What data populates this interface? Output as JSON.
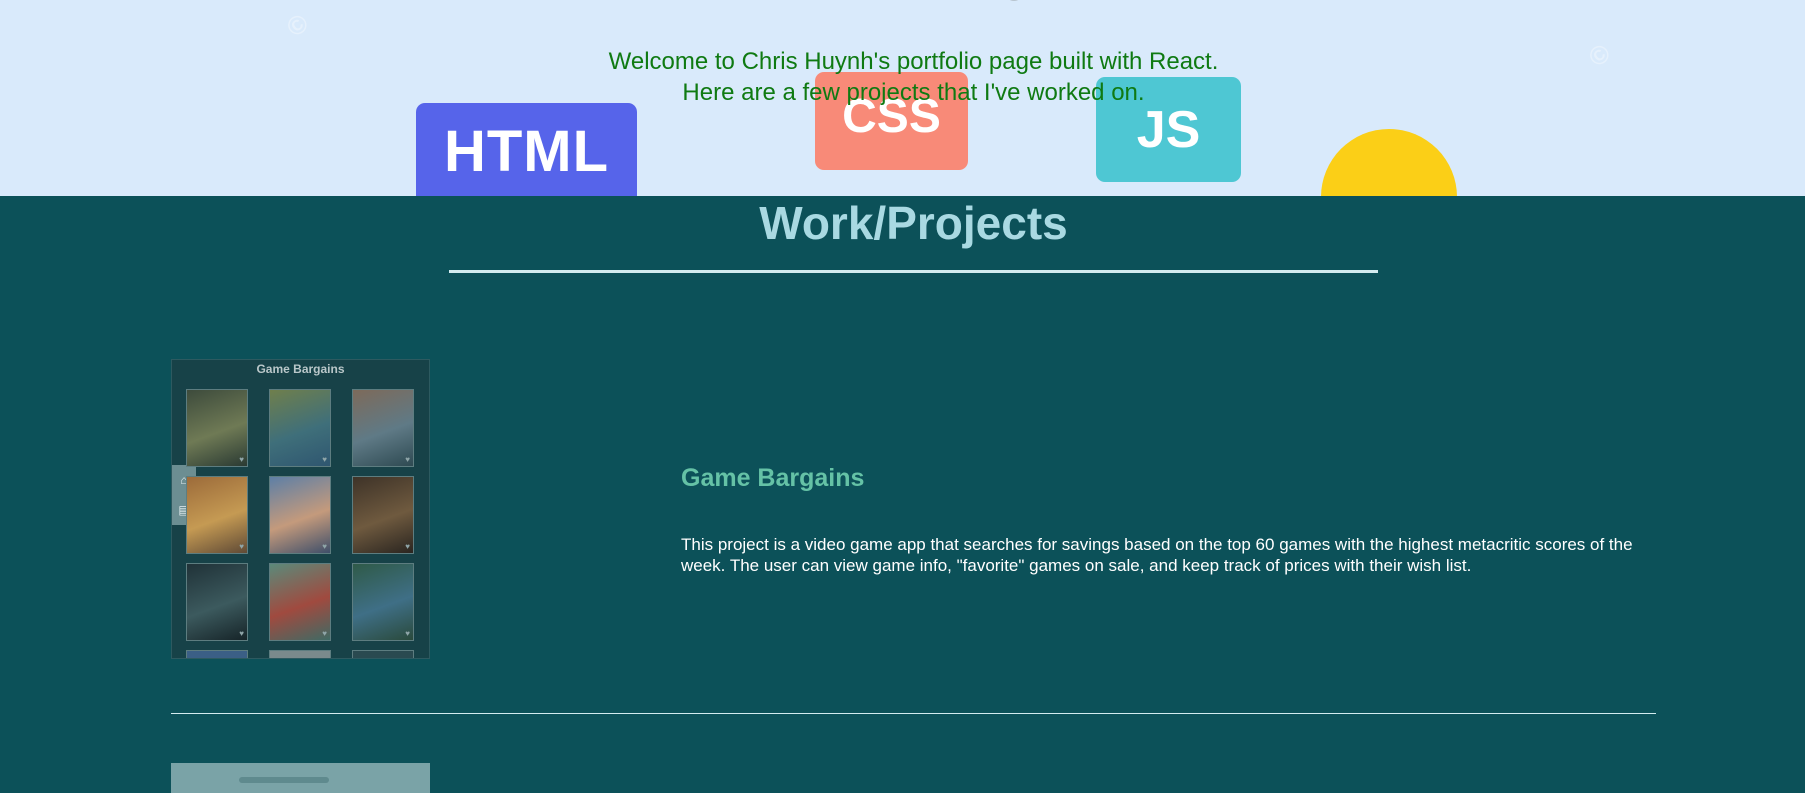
{
  "hero": {
    "line1": "Welcome to Chris Huynh's portfolio page built with React.",
    "line2": "Here are a few projects that I've worked on.",
    "tiles": {
      "html_label": "HTML",
      "css_label": "CSS",
      "js_label": "JS"
    },
    "colors": {
      "background": "#d9eafb",
      "text": "#0f7a12",
      "html_tile": "#5664ea",
      "css_tile": "#f88a78",
      "js_tile": "#4ec7d3",
      "sun": "#fbcf17"
    }
  },
  "projects": {
    "heading": "Work/Projects",
    "background": "#0c5159",
    "items": [
      {
        "title": "Game Bargains",
        "screenshot_title": "Game Bargains",
        "description": "This project is a video game app that searches for savings based on the top 60 games with the highest metacritic scores of the week. The user can view game info, \"favorite\" games on sale, and keep track of prices with their wish list."
      }
    ]
  }
}
